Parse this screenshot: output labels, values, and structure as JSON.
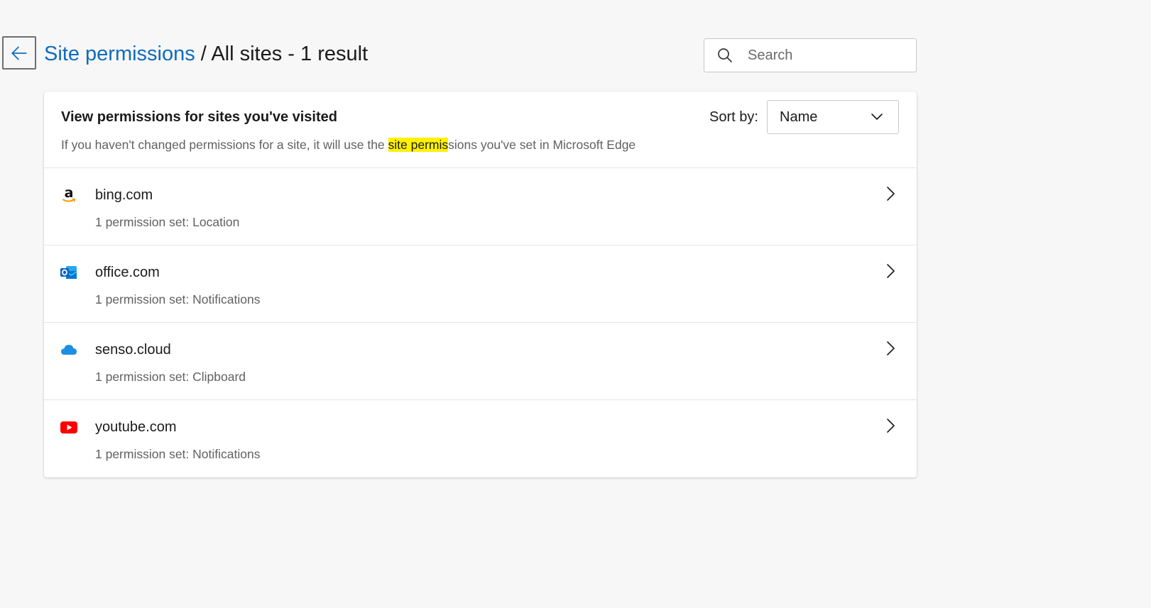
{
  "header": {
    "breadcrumb_link": "Site permissions",
    "breadcrumb_separator": " / ",
    "breadcrumb_current": "All sites - 1 result"
  },
  "search": {
    "placeholder": "Search",
    "value": ""
  },
  "card": {
    "title": "View permissions for sites you've visited",
    "description_before": "If you haven't changed permissions for a site, it will use the ",
    "description_highlight": "site permis",
    "description_after": "sions you've set in Microsoft Edge",
    "sort_label": "Sort by:",
    "sort_value": "Name"
  },
  "sites": [
    {
      "name": "bing.com",
      "permissions": "1 permission set: Location",
      "icon": "amazon-logo-icon"
    },
    {
      "name": "office.com",
      "permissions": "1 permission set: Notifications",
      "icon": "outlook-logo-icon"
    },
    {
      "name": "senso.cloud",
      "permissions": "1 permission set: Clipboard",
      "icon": "cloud-icon"
    },
    {
      "name": "youtube.com",
      "permissions": "1 permission set: Notifications",
      "icon": "youtube-logo-icon"
    }
  ],
  "colors": {
    "link": "#0f6cbd",
    "highlight": "#fff200",
    "youtube_red": "#ff0000",
    "cloud_blue": "#1a8fe3",
    "outlook_blue": "#0a64c4",
    "amazon_orange": "#ff9900"
  }
}
